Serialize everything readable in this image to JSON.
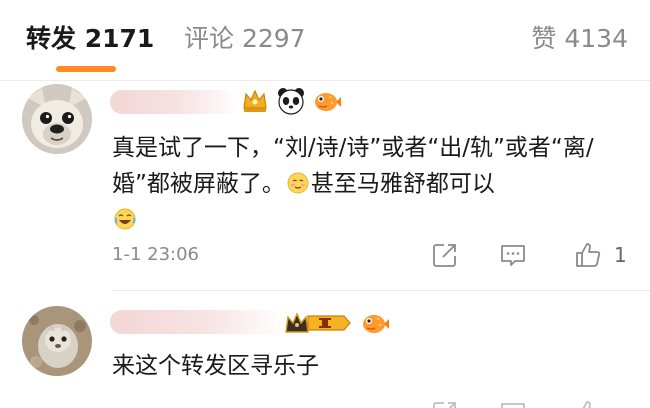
{
  "tabs": {
    "repost_label": "转发 2171",
    "comments_label": "评论 2297",
    "likes_label": "赞 4134",
    "accent": "#ff8a1f"
  },
  "comments": [
    {
      "avatar": "french-bulldog-avatar",
      "badges": [
        "gold-crown-badge",
        "panda-badge",
        "pufferfish-badge"
      ],
      "text_part1": "真是试了一下，“刘/诗/诗”或者“出/轨”或者“离/婚”都被屏蔽了。",
      "emoji_mid": "blushing-smile-emoji",
      "text_part2": "甚至马雅舒都可以",
      "emoji_end": "laughing-tears-emoji",
      "time": "1-1 23:06",
      "like_count": "1"
    },
    {
      "avatar": "pet-animal-avatar",
      "badges": [
        "vip-level-i-badge",
        "pufferfish-badge"
      ],
      "text": "来这个转发区寻乐子"
    }
  ]
}
